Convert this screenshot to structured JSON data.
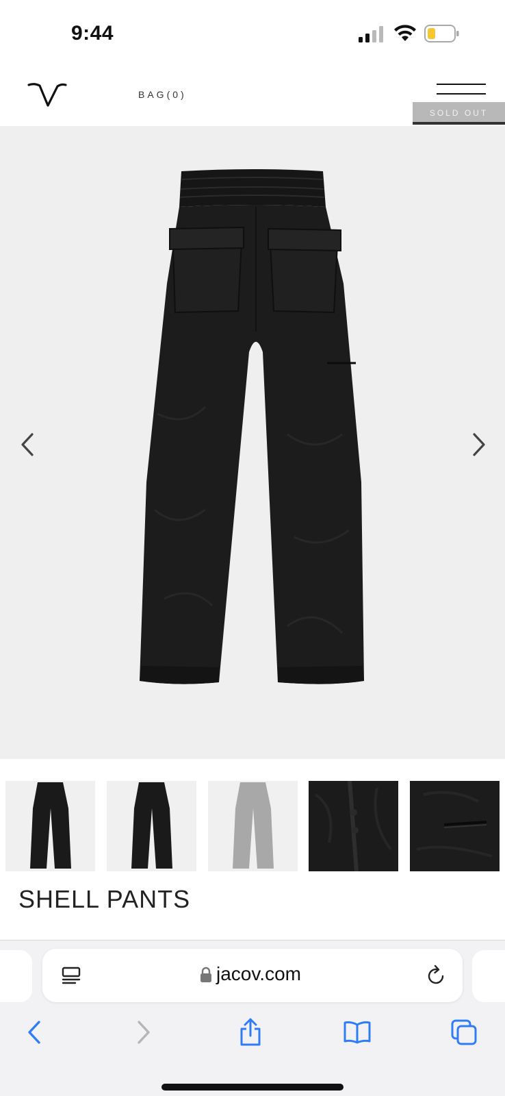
{
  "status_bar": {
    "time": "9:44"
  },
  "header": {
    "logo_icon": "v-logo-icon",
    "bag_label": "BAG(0)",
    "menu_icon": "hamburger-menu-icon",
    "sold_out_label": "SOLD OUT"
  },
  "gallery": {
    "prev_icon": "chevron-left-icon",
    "next_icon": "chevron-right-icon",
    "thumbnail_count": 5,
    "selected_thumbnail": 1
  },
  "product": {
    "title": "SHELL PANTS"
  },
  "browser": {
    "url": "jacov.com",
    "accent_color": "#2f7cf6",
    "toolbar_icons": [
      "back-icon",
      "forward-icon",
      "share-icon",
      "bookmarks-icon",
      "tabs-icon"
    ]
  },
  "colors": {
    "hero_background": "#efefef",
    "garment": "#1c1c1c",
    "sold_out_bar": "#b8b8b8"
  }
}
